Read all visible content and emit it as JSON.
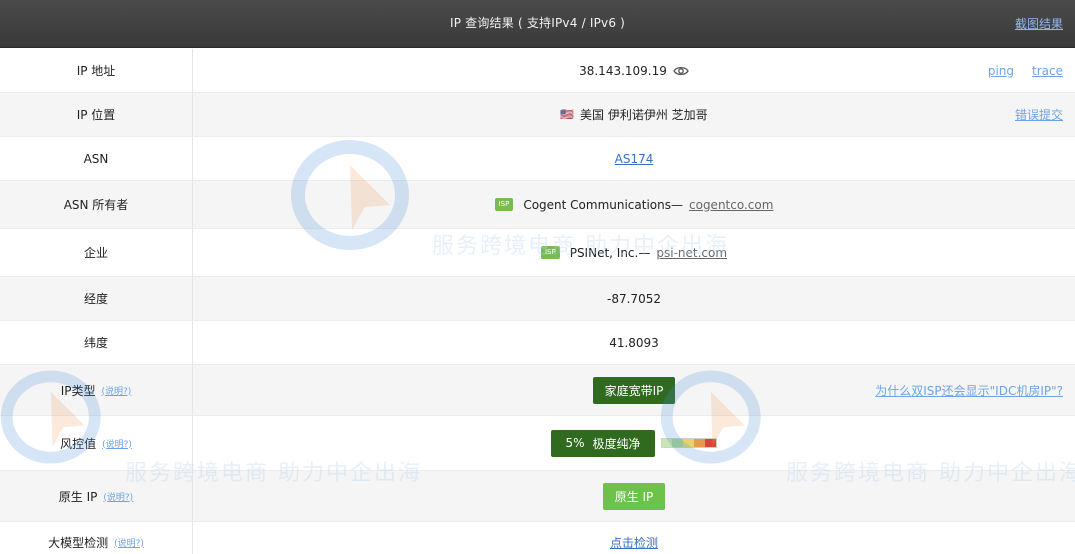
{
  "header": {
    "title": "IP 查询结果 ( 支持IPv4 / IPv6 )",
    "right_link": "截图结果"
  },
  "rows": {
    "ip": {
      "label": "IP 地址",
      "value": "38.143.109.19",
      "link_ping": "ping",
      "link_trace": "trace"
    },
    "location": {
      "label": "IP 位置",
      "flag": "🇺🇸",
      "value": "美国 伊利诺伊州 芝加哥",
      "link_report": "错误提交"
    },
    "asn": {
      "label": "ASN",
      "value": "AS174"
    },
    "asn_owner": {
      "label": "ASN 所有者",
      "badge": "ISP",
      "name": "Cogent Communications—",
      "domain": "cogentco.com"
    },
    "company": {
      "label": "企业",
      "badge": "ISP",
      "name": "PSINet, Inc.—",
      "domain": "psi-net.com"
    },
    "longitude": {
      "label": "经度",
      "value": "-87.7052"
    },
    "latitude": {
      "label": "纬度",
      "value": "41.8093"
    },
    "ip_type": {
      "label": "IP类型",
      "help": "(说明?)",
      "tag": "家庭宽带IP",
      "link": "为什么双ISP还会显示\"IDC机房IP\"?"
    },
    "risk": {
      "label": "风控值",
      "help": "(说明?)",
      "percent": "5%",
      "status": "极度纯净",
      "level": 0.05
    },
    "native_ip": {
      "label": "原生 IP",
      "help": "(说明?)",
      "tag": "原生 IP"
    },
    "llm_check": {
      "label": "大模型检测",
      "help": "(说明?)",
      "link": "点击检测"
    }
  },
  "watermark": {
    "text": "服务跨境电商 助力中企出海"
  },
  "colors": {
    "header_bg": "#404040",
    "tag_dark": "#2f6a1f",
    "tag_light": "#6cc24a",
    "link": "#3a6fc4",
    "isp_badge": "#77bb55"
  }
}
